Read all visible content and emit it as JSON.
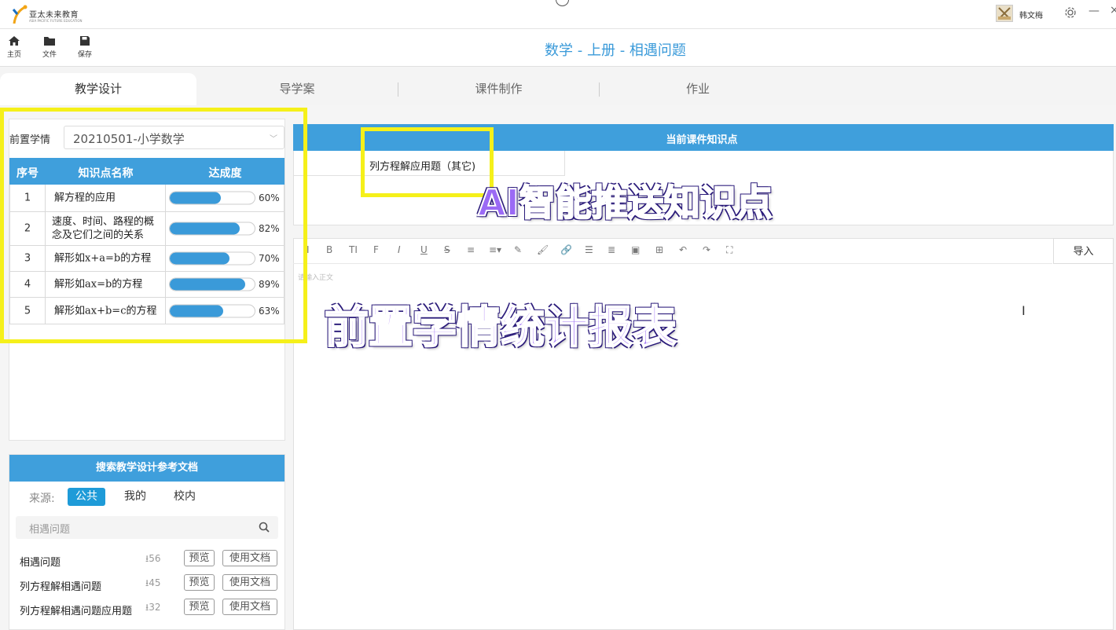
{
  "titlebar": {
    "logo_text": "亚太未来教育",
    "logo_subtext": "ASIA PACIFIC FUTURE EDUCATION",
    "user_name": "韩文梅",
    "settings_icon": "gear-icon",
    "minimize_glyph": "—",
    "close_glyph": "×"
  },
  "toolbar": {
    "home_label": "主页",
    "file_label": "文件",
    "save_label": "保存",
    "doc_title": "数学 - 上册 - 相遇问题"
  },
  "tabs": [
    {
      "label": "教学设计",
      "active": true
    },
    {
      "label": "导学案",
      "active": false
    },
    {
      "label": "课件制作",
      "active": false
    },
    {
      "label": "作业",
      "active": false
    }
  ],
  "pre_study": {
    "label": "前置学情",
    "selected": "20210501-小学数学",
    "columns": [
      "序号",
      "知识点名称",
      "达成度"
    ],
    "rows": [
      {
        "no": "1",
        "name": "解方程的应用",
        "percent": 60,
        "percent_text": "60%"
      },
      {
        "no": "2",
        "name": "速度、时间、路程的概念及它们之间的关系",
        "percent": 82,
        "percent_text": "82%"
      },
      {
        "no": "3",
        "name": "解形如x+a=b的方程",
        "percent": 70,
        "percent_text": "70%"
      },
      {
        "no": "4",
        "name": "解形如ax=b的方程",
        "percent": 89,
        "percent_text": "89%"
      },
      {
        "no": "5",
        "name": "解形如ax+b=c的方程",
        "percent": 63,
        "percent_text": "63%"
      }
    ]
  },
  "search": {
    "header": "搜索教学设计参考文档",
    "source_label": "来源:",
    "sources": [
      {
        "label": "公共",
        "active": true
      },
      {
        "label": "我的",
        "active": false
      },
      {
        "label": "校内",
        "active": false
      }
    ],
    "placeholder": "相遇问题",
    "preview_label": "预览",
    "use_label": "使用文档",
    "docs": [
      {
        "name": "相遇问题",
        "downloads": "56"
      },
      {
        "name": "列方程解相遇问题",
        "downloads": "45"
      },
      {
        "name": "列方程解相遇问题应用题",
        "downloads": "32"
      }
    ]
  },
  "knowledge": {
    "header": "当前课件知识点",
    "item": "列方程解应用题（其它)"
  },
  "editor": {
    "toolbar": [
      "I",
      "B",
      "TI",
      "F",
      "I",
      "U",
      "S",
      "≡",
      "≡▾",
      "✎",
      "🖌",
      "🔗",
      "☰",
      "≣",
      "▣",
      "⊞",
      "↶",
      "↷",
      "⛶"
    ],
    "import_label": "导入",
    "placeholder": "请输入正文"
  },
  "overlays": {
    "ai_text": "AI智能推送知识点",
    "report_text": "前置学情统计报表",
    "highlight_color": "#f5f01a",
    "text_color": "#9b6af5"
  },
  "colors": {
    "accent": "#3a9ad9",
    "header_blue": "#3f9fdc"
  }
}
